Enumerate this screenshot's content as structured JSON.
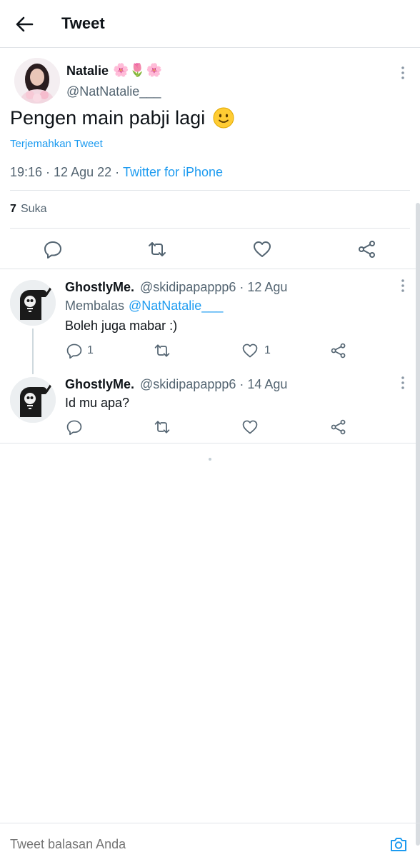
{
  "header": {
    "title": "Tweet"
  },
  "tweet": {
    "author_name": "Natalie",
    "author_emoji": "🌸🌷🌸",
    "handle": "@NatNatalie___",
    "text": "Pengen main pabji lagi",
    "translate_label": "Terjemahkan Tweet",
    "time": "19:16 · 12 Agu 22 ·",
    "source": "Twitter for iPhone",
    "likes_count": "7",
    "likes_label": "Suka"
  },
  "replies": [
    {
      "name": "GhostlyMe.",
      "meta": "@skidipapappp6 · 12 Agu",
      "replying_label": "Membalas",
      "replying_to": "@NatNatalie___",
      "text": "Boleh juga mabar :)",
      "reply_count": "1",
      "like_count": "1"
    },
    {
      "name": "GhostlyMe.",
      "meta": "@skidipapappp6 · 14 Agu",
      "text": "Id mu apa?"
    }
  ],
  "compose": {
    "placeholder": "Tweet balasan Anda"
  },
  "colors": {
    "accent": "#1d9bf0",
    "secondary_text": "#536471",
    "divider": "#e1e4e8"
  }
}
